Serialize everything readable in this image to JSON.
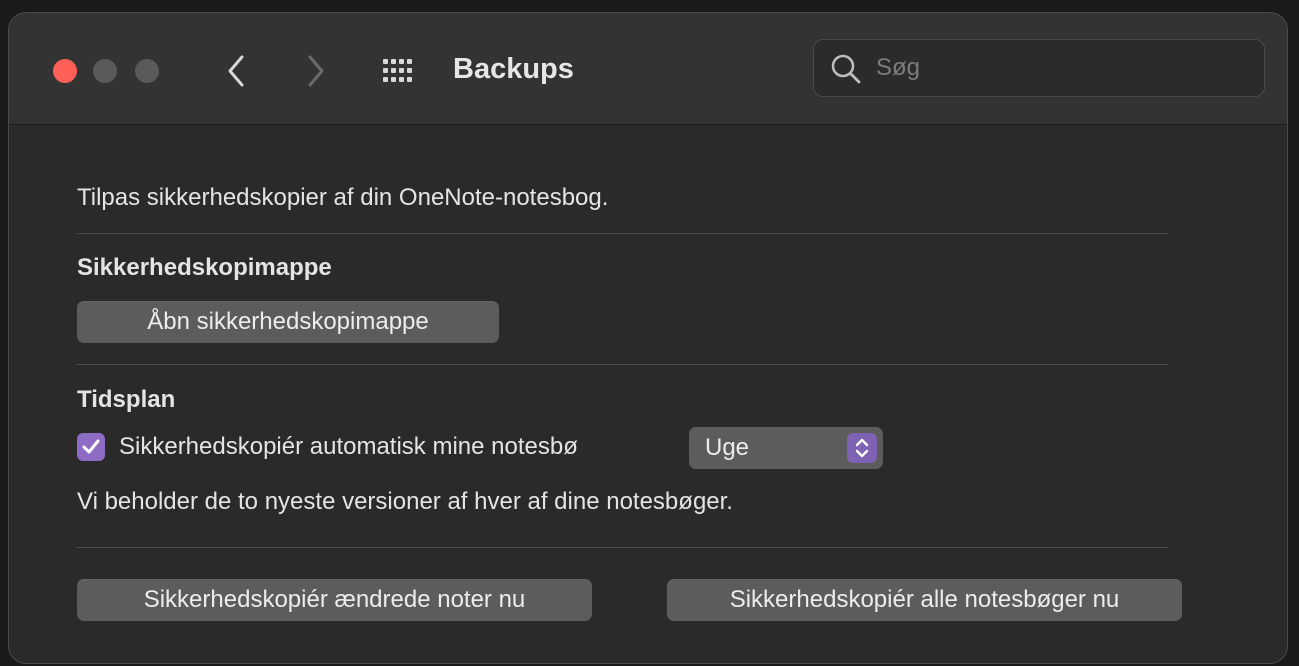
{
  "window": {
    "title": "Backups"
  },
  "search": {
    "placeholder": "Søg",
    "value": ""
  },
  "content": {
    "intro": "Tilpas sikkerhedskopier af din OneNote-notesbog.",
    "folder_section": {
      "heading": "Sikkerhedskopimappe",
      "open_button": "Åbn sikkerhedskopimappe"
    },
    "schedule_section": {
      "heading": "Tidsplan",
      "auto_backup_label": "Sikkerhedskopiér automatisk mine notesbø",
      "auto_backup_checked": true,
      "frequency_selected": "Uge",
      "retention_note": "Vi beholder de to nyeste versioner af hver af dine notesbøger."
    },
    "actions": {
      "backup_changed": "Sikkerhedskopiér ændrede noter nu",
      "backup_all": "Sikkerhedskopiér alle notesbøger nu"
    }
  },
  "colors": {
    "close_light": "#fe5f57",
    "accent": "#8d6cc6",
    "window_bg": "#2a2a2a",
    "titlebar_bg": "#333333"
  },
  "icons": [
    "back-chevron-icon",
    "forward-chevron-icon",
    "grid-icon",
    "search-icon",
    "checkmark-icon",
    "updown-chevron-icon"
  ]
}
